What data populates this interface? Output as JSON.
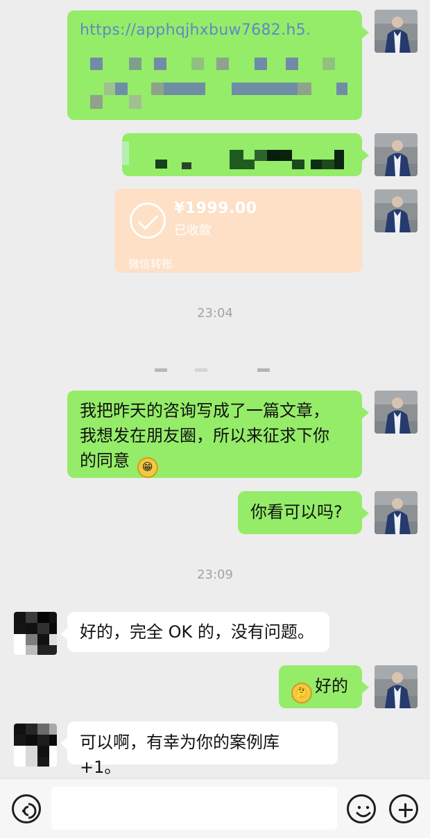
{
  "chat": {
    "message_link": "https://apphqjhxbuw7682.h5.",
    "transfer_amount": "¥1999.00",
    "transfer_status": "已收款",
    "transfer_source": "微信转账",
    "time_1": "23:04",
    "message_1_lines": [
      "我把昨天的咨询写成了一篇文章，",
      "我想发在朋友圈，所以来征求下你",
      "的同意"
    ],
    "message_2": "你看可以吗?",
    "time_2": "23:09",
    "reply_1": "好的，完全 OK 的，没有问题。",
    "message_3": "好的",
    "reply_2": "可以啊，有幸为你的案例库 +1。"
  },
  "icons": {
    "voice": "voice-icon",
    "emoji": "emoji-icon",
    "plus": "plus-icon",
    "check": "check-icon"
  },
  "colors": {
    "background": "#ededed",
    "sent_bubble": "#95ec69",
    "received_bubble": "#ffffff",
    "transfer_card": "#fde0c6"
  }
}
